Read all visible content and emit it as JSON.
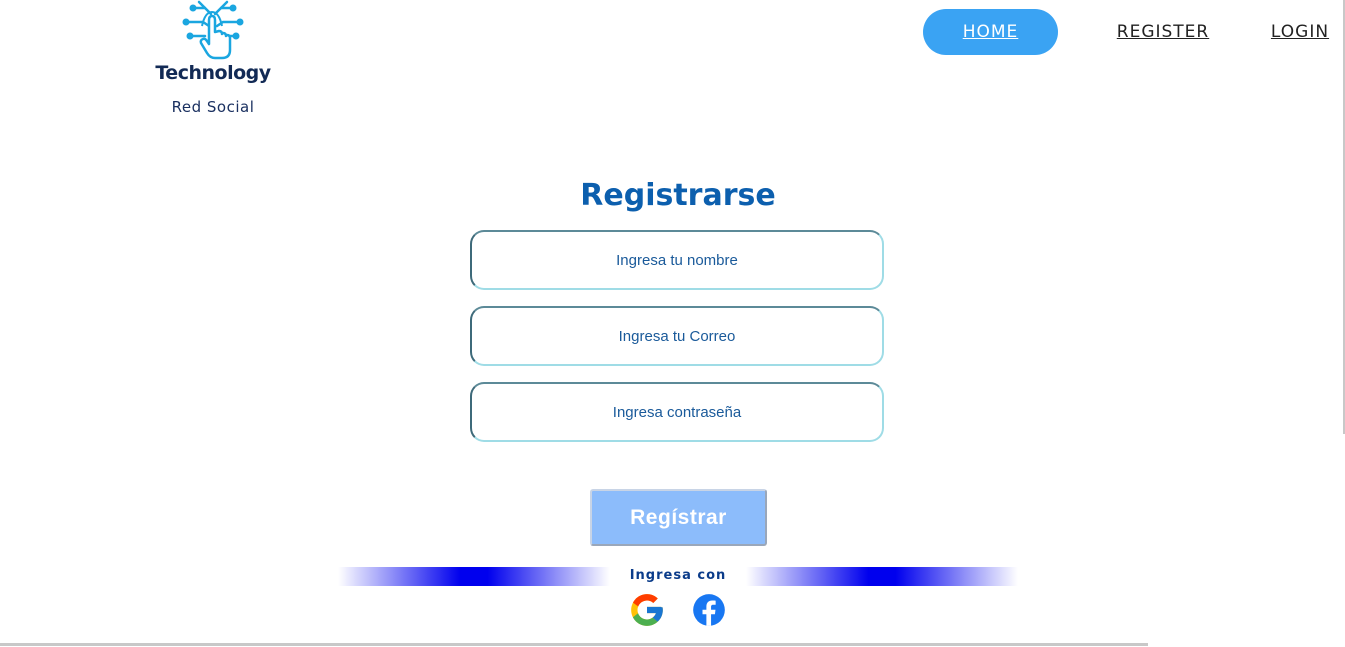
{
  "brand": {
    "title": "Technology",
    "subtitle": "Red Social",
    "icon": "touch-network-icon"
  },
  "nav": {
    "items": [
      {
        "label": "HOME",
        "active": true
      },
      {
        "label": "REGISTER",
        "active": false
      },
      {
        "label": "LOGIN",
        "active": false
      }
    ]
  },
  "form": {
    "title": "Registrarse",
    "name_placeholder": "Ingresa tu nombre",
    "email_placeholder": "Ingresa tu Correo",
    "password_placeholder": "Ingresa contraseña",
    "submit_label": "Regístrar"
  },
  "social": {
    "label": "Ingresa con",
    "providers": [
      {
        "name": "google",
        "icon": "google-icon"
      },
      {
        "name": "facebook",
        "icon": "facebook-icon"
      }
    ]
  },
  "colors": {
    "accent": "#3aa3f3",
    "title": "#0c5fae",
    "button": "#8cbcfb",
    "divider": "#0000ee",
    "facebook": "#1877f2"
  }
}
